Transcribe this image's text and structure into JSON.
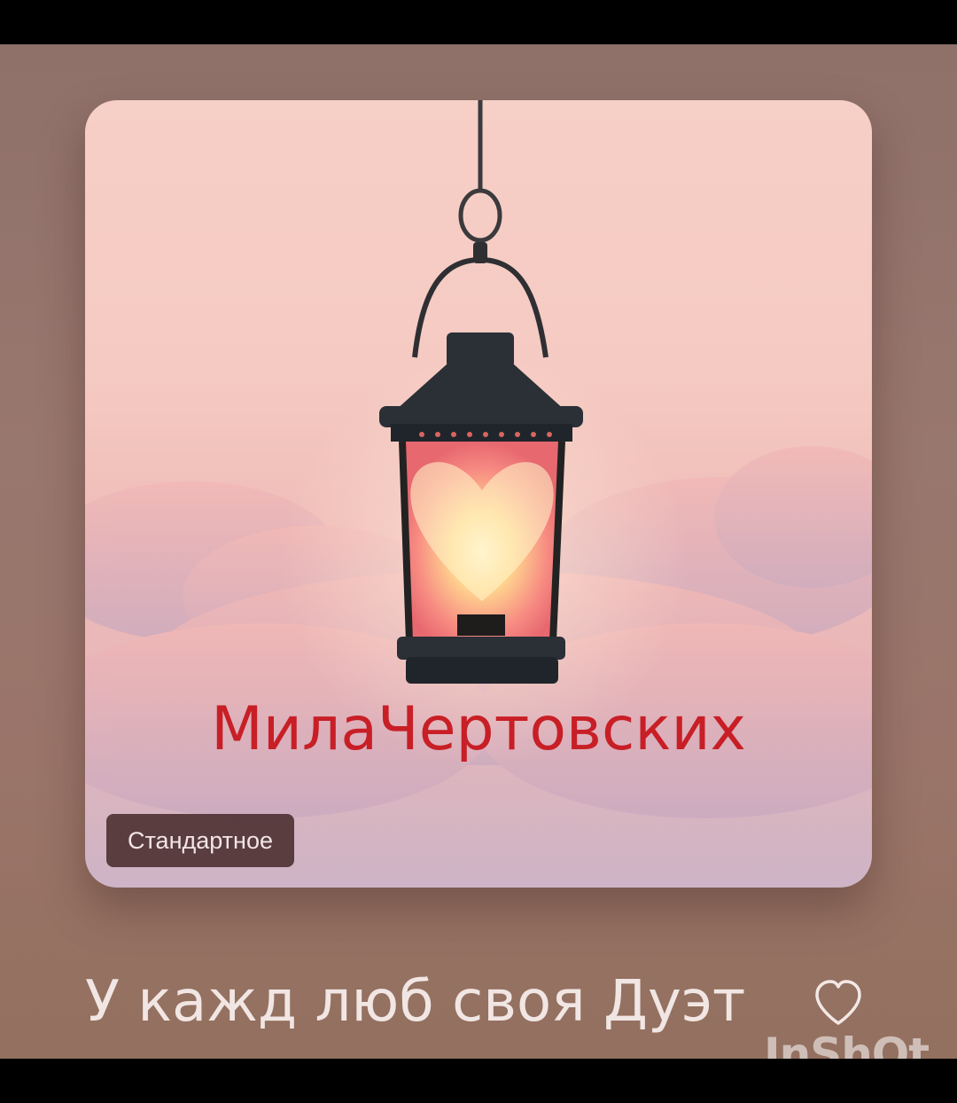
{
  "cover": {
    "artist_overlay": "МилаЧертовских",
    "quality_badge": "Стандартное",
    "icon": "heart-lantern-art"
  },
  "track": {
    "title": "У кажд люб своя Дуэт",
    "like_icon": "heart-outline-icon"
  },
  "watermark": "InShOt",
  "colors": {
    "artist_text": "#c81f26",
    "badge_bg": "#44282a",
    "title_text": "#f1e6e3",
    "background": "#98776e"
  }
}
